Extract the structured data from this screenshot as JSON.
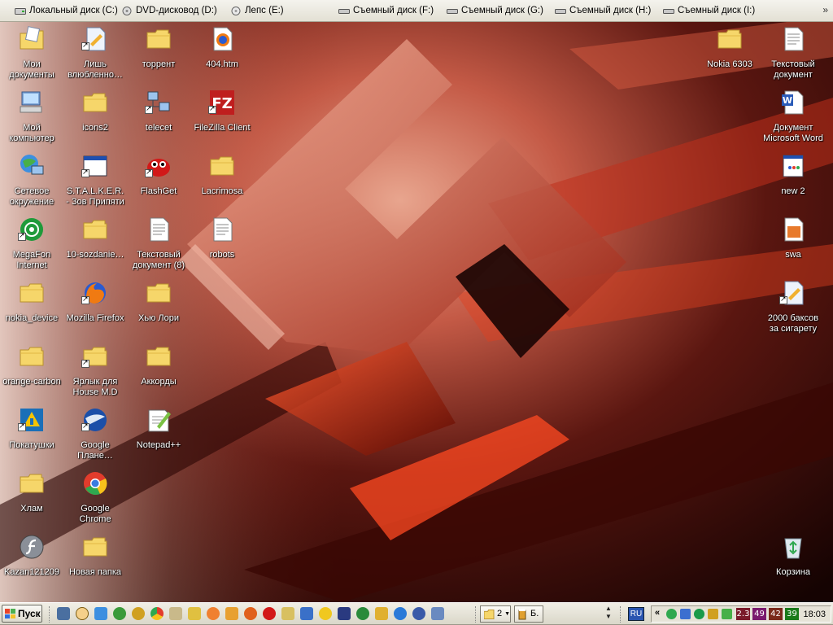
{
  "drive_bar": {
    "drives": [
      {
        "label": "Локальный диск (C:)",
        "icon": "hard-disk-icon"
      },
      {
        "label": "DVD-дисковод (D:)",
        "icon": "dvd-drive-icon"
      },
      {
        "label": "Лепс (E:)",
        "icon": "dvd-disc-icon"
      },
      {
        "label": "Съемный диск (F:)",
        "icon": "removable-disk-icon"
      },
      {
        "label": "Съемный диск (G:)",
        "icon": "removable-disk-icon"
      },
      {
        "label": "Съемный диск (H:)",
        "icon": "removable-disk-icon"
      },
      {
        "label": "Съемный диск (I:)",
        "icon": "removable-disk-icon"
      }
    ],
    "more": "»"
  },
  "desktop": {
    "icons": [
      {
        "label": "Мои документы",
        "icon": "my-documents-icon"
      },
      {
        "label": "Мой компьютер",
        "icon": "my-computer-icon"
      },
      {
        "label": "Сетевое окружение",
        "icon": "network-places-icon"
      },
      {
        "label": "MegaFon Internet",
        "icon": "megafon-icon"
      },
      {
        "label": "nokia_device",
        "icon": "folder-icon"
      },
      {
        "label": "orange-carbon",
        "icon": "folder-icon"
      },
      {
        "label": "Покатушки",
        "icon": "game-shortcut-icon"
      },
      {
        "label": "Хлам",
        "icon": "folder-icon"
      },
      {
        "label": "Kazan121209",
        "icon": "flash-icon"
      },
      {
        "label": "Лишь влюбленно…",
        "icon": "document-shortcut-icon"
      },
      {
        "label": "icons2",
        "icon": "folder-icon"
      },
      {
        "label": "S.T.A.L.K.E.R. - Зов Припяти",
        "icon": "window-shortcut-icon"
      },
      {
        "label": "10-sozdanie…",
        "icon": "folder-icon"
      },
      {
        "label": "Mozilla Firefox",
        "icon": "firefox-icon"
      },
      {
        "label": "Ярлык для House M.D",
        "icon": "folder-shortcut-icon"
      },
      {
        "label": "Google Плане…",
        "icon": "google-earth-icon"
      },
      {
        "label": "Google Chrome",
        "icon": "chrome-icon"
      },
      {
        "label": "Новая папка",
        "icon": "folder-icon"
      },
      {
        "label": "торрент",
        "icon": "folder-icon"
      },
      {
        "label": "telecet",
        "icon": "network-shortcut-icon"
      },
      {
        "label": "FlashGet",
        "icon": "flashget-icon"
      },
      {
        "label": "Текстовый документ (8)",
        "icon": "text-document-icon"
      },
      {
        "label": "Хью Лори",
        "icon": "folder-icon"
      },
      {
        "label": "Аккорды",
        "icon": "folder-icon"
      },
      {
        "label": "Notepad++",
        "icon": "notepad-plus-icon"
      },
      {
        "label": "404.htm",
        "icon": "html-document-icon"
      },
      {
        "label": "FileZilla Client",
        "icon": "filezilla-icon"
      },
      {
        "label": "Lacrimosa",
        "icon": "folder-icon"
      },
      {
        "label": "robots",
        "icon": "text-document-icon"
      },
      {
        "label": "Nokia 6303",
        "icon": "folder-icon"
      },
      {
        "label": "Текстовый документ",
        "icon": "text-document-icon"
      },
      {
        "label": "Документ Microsoft Word",
        "icon": "word-document-icon"
      },
      {
        "label": "new 2",
        "icon": "notepad-file-icon"
      },
      {
        "label": "swa",
        "icon": "swa-file-icon"
      },
      {
        "label": "2000 баксов за сигарету",
        "icon": "document-shortcut-icon"
      },
      {
        "label": "Корзина",
        "icon": "recycle-bin-icon"
      }
    ]
  },
  "taskbar": {
    "start_label": "Пуск",
    "quick_launch": [
      "calculator-icon",
      "info-icon",
      "network-icon",
      "globe-icon",
      "globe-icon",
      "chrome-icon",
      "warning-icon",
      "archiver-icon",
      "at-icon",
      "glasses-icon",
      "firefox-icon",
      "opera-icon",
      "puzzle-icon",
      "ship-icon",
      "radiation-icon",
      "floppy-icon",
      "refresh-icon",
      "pen-icon",
      "ie-icon",
      "media-player-icon",
      "clipboard-icon"
    ],
    "tasks": [
      {
        "label": "2",
        "icon": "folder-icon"
      },
      {
        "label": "Б.",
        "icon": "beer-icon"
      }
    ],
    "language": "RU",
    "tray": {
      "chevron": "«",
      "meters": [
        {
          "value": "2.3",
          "color": "#7a1a2a"
        },
        {
          "value": "49",
          "color": "#7a1a6e"
        },
        {
          "value": "42",
          "color": "#7a2a1a"
        },
        {
          "value": "39",
          "color": "#1a7a1a"
        }
      ],
      "clock": "18:03"
    }
  }
}
